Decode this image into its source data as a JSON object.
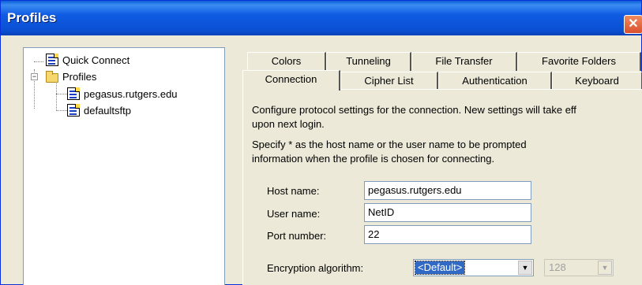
{
  "window": {
    "title": "Profiles",
    "close_glyph": "✕"
  },
  "tree": {
    "items": [
      {
        "label": "Quick Connect",
        "icon": "quick-connect-icon"
      },
      {
        "label": "Profiles",
        "icon": "folder-icon",
        "expander": "−"
      },
      {
        "label": "pegasus.rutgers.edu",
        "icon": "profile-icon"
      },
      {
        "label": "defaultsftp",
        "icon": "profile-icon"
      }
    ]
  },
  "tabs": {
    "row1": [
      "Colors",
      "Tunneling",
      "File Transfer",
      "Favorite Folders"
    ],
    "row2": [
      "Connection",
      "Cipher List",
      "Authentication",
      "Keyboard"
    ],
    "active": "Connection"
  },
  "connection": {
    "desc1": "Configure protocol settings for the connection. New settings will take eff upon next login.",
    "desc1_line1": "Configure protocol settings for the connection. New settings will take eff",
    "desc1_line2": "upon next login.",
    "desc2_line1": "Specify * as the host name or the user name to be prompted",
    "desc2_line2": "information when the profile is chosen for connecting.",
    "host_label": "Host name:",
    "host_value": "pegasus.rutgers.edu",
    "user_label": "User name:",
    "user_value": "NetID",
    "port_label": "Port number:",
    "port_value": "22",
    "enc_label": "Encryption algorithm:",
    "enc_value": "<Default>",
    "keysize_value": "128",
    "dropdown_glyph": "▼"
  },
  "colors": {
    "titlebar": "#0a4fd3",
    "selection": "#316ac5",
    "dialog_bg": "#ece9d8"
  }
}
